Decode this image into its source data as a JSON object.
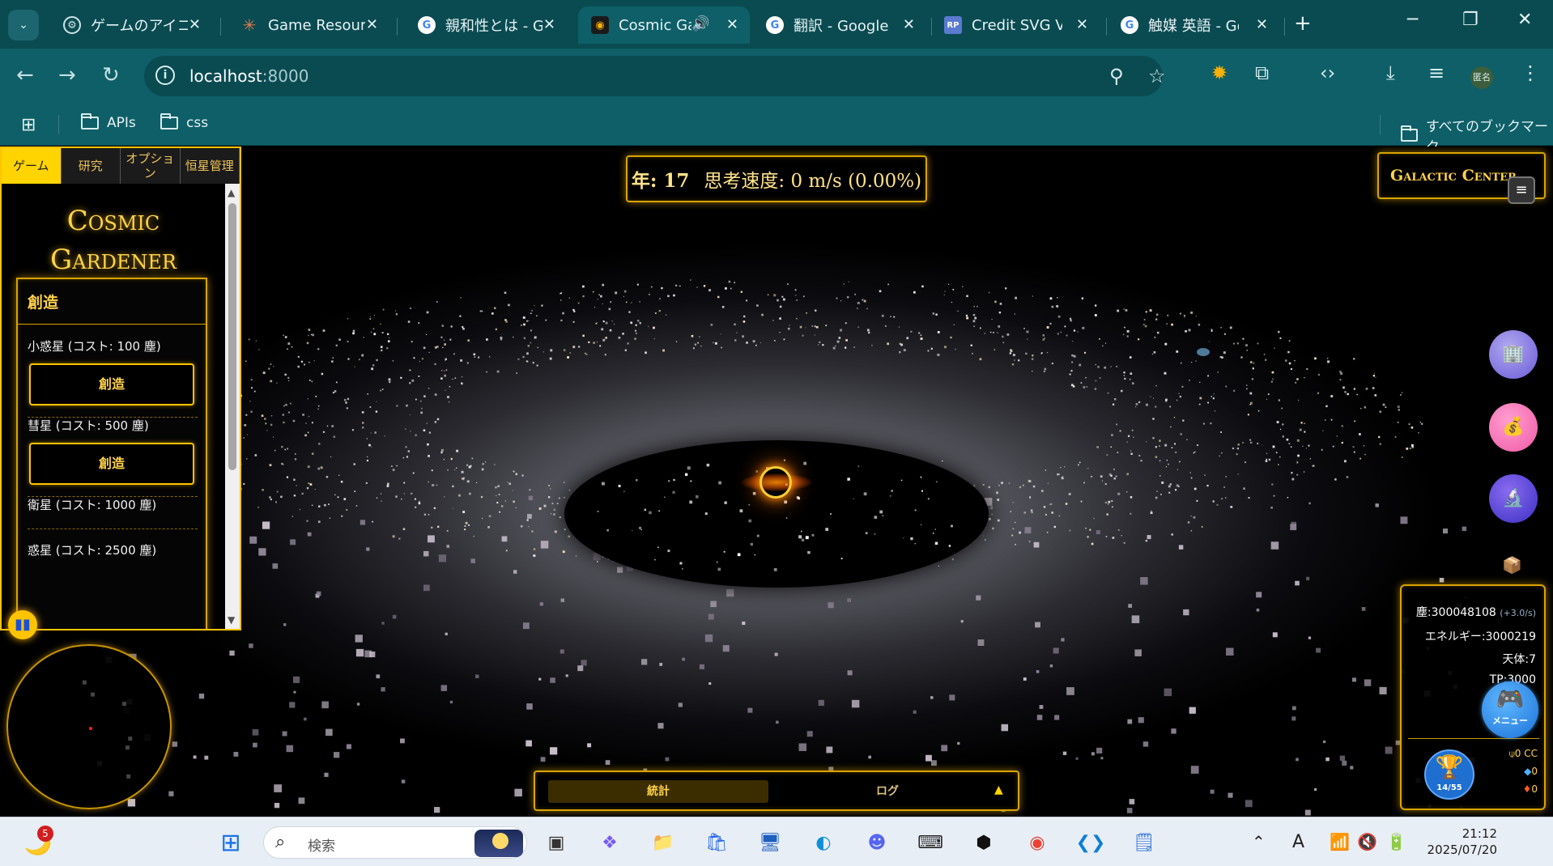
{
  "browser": {
    "tabs": [
      {
        "title": "ゲームのアイコン",
        "favicon": "chatgpt-icon"
      },
      {
        "title": "Game Resources",
        "favicon": "claude-icon"
      },
      {
        "title": "親和性とは - Go",
        "favicon": "google-icon"
      },
      {
        "title": "Cosmic Gardener",
        "favicon": "game-icon",
        "active": true,
        "audio": true
      },
      {
        "title": "翻訳 - Google 翻",
        "favicon": "google-icon"
      },
      {
        "title": "Credit SVG Vect",
        "favicon": "svgrepo-icon"
      },
      {
        "title": "触媒 英語 - Goo",
        "favicon": "google-icon"
      }
    ],
    "url_host": "localhost",
    "url_port": ":8000",
    "profile_label": "匿名",
    "bookmarks": [
      {
        "label": "APIs"
      },
      {
        "label": "css"
      }
    ],
    "all_bookmarks_label": "すべてのブックマーク"
  },
  "game": {
    "title_line1": "Cosmic",
    "title_line2": "Gardener",
    "left_tabs": [
      "ゲーム",
      "研究",
      "オプション",
      "恒星管理"
    ],
    "create_header": "創造",
    "create_items": [
      {
        "label": "小惑星 (コスト: 100 塵)",
        "button": "創造"
      },
      {
        "label": "彗星 (コスト: 500 塵)",
        "button": "創造"
      },
      {
        "label": "衛星 (コスト: 1000 塵)"
      },
      {
        "label": "惑星 (コスト: 2500 塵)"
      }
    ],
    "year_label": "年: 17",
    "thought_speed": "思考速度: 0 m/s (0.00%)",
    "galactic_center": "Galactic Center",
    "resources": {
      "dust": "塵:300048108",
      "dust_rate": "(+3.0/s)",
      "energy": "エネルギー:3000219",
      "bodies": "天体:7",
      "tp": "TP:3000"
    },
    "currencies": [
      "0 CC",
      "0",
      "0"
    ],
    "achievements": "14/55",
    "menu_label": "メニュー",
    "bottom_tabs": [
      "統計",
      "ログ"
    ],
    "accent_color": "#ffc400"
  },
  "taskbar": {
    "search_placeholder": "検索",
    "weather_badge": "5",
    "time": "21:12",
    "date": "2025/07/20",
    "ime": "A"
  }
}
